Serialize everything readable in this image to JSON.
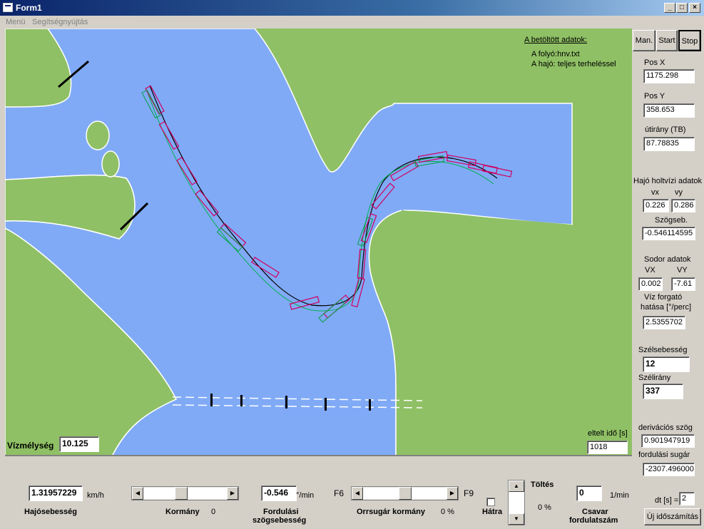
{
  "window": {
    "title": "Form1",
    "min": "_",
    "max": "□",
    "close": "×"
  },
  "menu": {
    "items": [
      "Menü",
      "Segítségnyújtás"
    ]
  },
  "map": {
    "loaded_header": "A betöltött adatok:",
    "river_line": "A folyó:hnv.txt",
    "ship_line": "A hajó: teljes terheléssel",
    "depth_label": "Vízmélység",
    "depth_value": "10.125",
    "elapsed_label": "eltelt idő [s]",
    "elapsed_value": "1018",
    "colors": {
      "land": "#8fc065",
      "water": "#80aaf6"
    }
  },
  "side": {
    "man": "Man.",
    "start": "Start",
    "stop": "Stop",
    "posx_label": "Pos X",
    "posx": "1175.298",
    "posy_label": "Pos Y",
    "posy": "358.653",
    "heading_label": "útirány (TB)",
    "heading": "87.78835",
    "dead_water_label": "Hajó holtvízi adatok",
    "vx_label": "vx",
    "vy_label": "vy",
    "vx": "0.226",
    "vy": "0.286",
    "angvel_label": "Szögseb.",
    "angvel": "-0.546114595",
    "drift_label": "Sodor adatok",
    "VX_label": "VX",
    "VY_label": "VY",
    "VX": "0.002",
    "VY": "-7.61",
    "rot_label_1": "Víz forgató",
    "rot_label_2": "hatása [°/perc]",
    "rot": "2.5355702",
    "wind_speed_label": "Szélsebesség",
    "wind_speed": "12",
    "wind_dir_label": "Szélirány",
    "wind_dir": "337",
    "deriv_label": "derivációs szög",
    "deriv": "0.901947919",
    "radius_label": "fordulási sugár",
    "radius": "-2307.496000"
  },
  "bottom": {
    "speed": "1.31957229",
    "speed_unit": "km/h",
    "speed_label": "Hajósebesség",
    "rudder_label": "Kormány",
    "rudder_value": "0",
    "turn_rate": "-0.546",
    "turn_unit": "°/min",
    "turn_label_1": "Fordulási",
    "turn_label_2": "szögsebesség",
    "f6": "F6",
    "f9": "F9",
    "bow_label": "Orrsugár kormány",
    "bow_value": "0 %",
    "back_label": "Hátra",
    "fill_label": "Töltés",
    "fill_value": "0 %",
    "rpm": "0",
    "rpm_unit": "1/min",
    "rpm_label_1": "Csavar",
    "rpm_label_2": "fordulatszám",
    "dt_label": "dt [s] =",
    "dt": "2",
    "recalc": "Új időszámítás"
  }
}
